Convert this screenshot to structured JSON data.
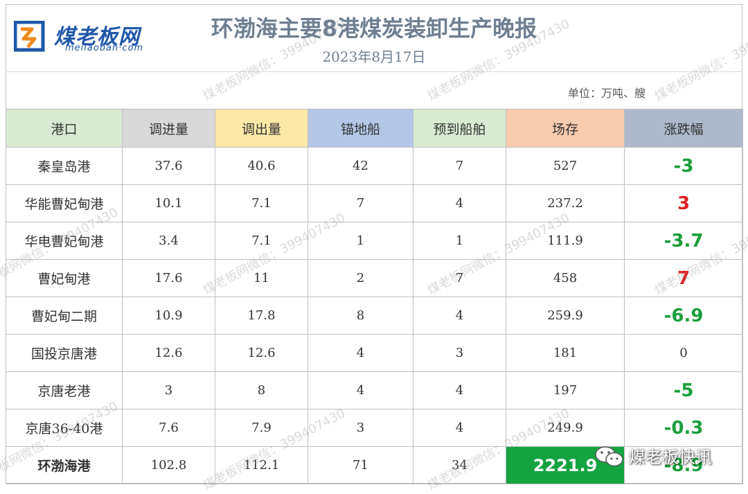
{
  "logo": {
    "cn": "煤老板网",
    "en": "meilaoban·com"
  },
  "title": "环渤海主要8港煤炭装卸生产晚报",
  "date": "2023年8月17日",
  "unit": "单位：万吨、艘",
  "colors": {
    "header_port": "#d9ead3",
    "header_in": "#d9d9d9",
    "header_out": "#fde9a7",
    "header_anchor": "#b4c7e7",
    "header_expected": "#d9ead3",
    "header_stock": "#f8cbad",
    "header_change": "#adb9ca",
    "rise": "#e02020",
    "fall": "#1a9e3a",
    "total_stock_bg": "#14a33f"
  },
  "table": {
    "headers": [
      "港口",
      "调进量",
      "调出量",
      "锚地船",
      "预到船舶",
      "场存",
      "涨跌幅"
    ],
    "rows": [
      {
        "port": "秦皇岛港",
        "in": "37.6",
        "out": "40.6",
        "anchor": "42",
        "expected": "7",
        "stock": "527",
        "change": "-3",
        "trend": "fall"
      },
      {
        "port": "华能曹妃甸港",
        "in": "10.1",
        "out": "7.1",
        "anchor": "7",
        "expected": "4",
        "stock": "237.2",
        "change": "3",
        "trend": "rise"
      },
      {
        "port": "华电曹妃甸港",
        "in": "3.4",
        "out": "7.1",
        "anchor": "1",
        "expected": "1",
        "stock": "111.9",
        "change": "-3.7",
        "trend": "fall"
      },
      {
        "port": "曹妃甸港",
        "in": "17.6",
        "out": "11",
        "anchor": "2",
        "expected": "7",
        "stock": "458",
        "change": "7",
        "trend": "rise"
      },
      {
        "port": "曹妃甸二期",
        "in": "10.9",
        "out": "17.8",
        "anchor": "8",
        "expected": "4",
        "stock": "259.9",
        "change": "-6.9",
        "trend": "fall"
      },
      {
        "port": "国投京唐港",
        "in": "12.6",
        "out": "12.6",
        "anchor": "4",
        "expected": "3",
        "stock": "181",
        "change": "0",
        "trend": "flat"
      },
      {
        "port": "京唐老港",
        "in": "3",
        "out": "8",
        "anchor": "4",
        "expected": "4",
        "stock": "197",
        "change": "-5",
        "trend": "fall"
      },
      {
        "port": "京唐36-40港",
        "in": "7.6",
        "out": "7.9",
        "anchor": "3",
        "expected": "4",
        "stock": "249.9",
        "change": "-0.3",
        "trend": "fall"
      }
    ],
    "total": {
      "port": "环渤海港",
      "in": "102.8",
      "out": "112.1",
      "anchor": "71",
      "expected": "34",
      "stock": "2221.9",
      "change": "-8.9",
      "trend": "fall"
    }
  },
  "watermark": {
    "text": "煤老板网微信：399407430"
  },
  "wechat": {
    "text": "煤老板快讯",
    "icon": "wechat-icon"
  }
}
